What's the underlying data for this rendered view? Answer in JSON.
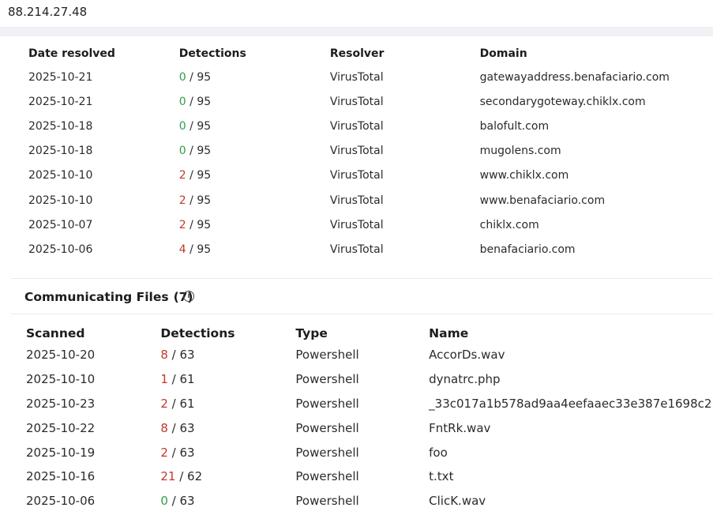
{
  "header": {
    "ip_address": "88.214.27.48"
  },
  "resolutions": {
    "columns": [
      "Date resolved",
      "Detections",
      "Resolver",
      "Domain"
    ],
    "rows": [
      {
        "date": "2025-10-21",
        "det": "0",
        "total": "95",
        "resolver": "VirusTotal",
        "domain": "gatewayaddress.benafaciario.com"
      },
      {
        "date": "2025-10-21",
        "det": "0",
        "total": "95",
        "resolver": "VirusTotal",
        "domain": "secondarygoteway.chiklx.com"
      },
      {
        "date": "2025-10-18",
        "det": "0",
        "total": "95",
        "resolver": "VirusTotal",
        "domain": "balofult.com"
      },
      {
        "date": "2025-10-18",
        "det": "0",
        "total": "95",
        "resolver": "VirusTotal",
        "domain": "mugolens.com"
      },
      {
        "date": "2025-10-10",
        "det": "2",
        "total": "95",
        "resolver": "VirusTotal",
        "domain": "www.chiklx.com"
      },
      {
        "date": "2025-10-10",
        "det": "2",
        "total": "95",
        "resolver": "VirusTotal",
        "domain": "www.benafaciario.com"
      },
      {
        "date": "2025-10-07",
        "det": "2",
        "total": "95",
        "resolver": "VirusTotal",
        "domain": "chiklx.com"
      },
      {
        "date": "2025-10-06",
        "det": "4",
        "total": "95",
        "resolver": "VirusTotal",
        "domain": "benafaciario.com"
      }
    ]
  },
  "communicating_files": {
    "title": "Communicating Files",
    "count": "(7)",
    "info_icon": "info-icon",
    "columns": [
      "Scanned",
      "Detections",
      "Type",
      "Name"
    ],
    "rows": [
      {
        "scanned": "2025-10-20",
        "det": "8",
        "total": "63",
        "type": "Powershell",
        "name": "AccorDs.wav"
      },
      {
        "scanned": "2025-10-10",
        "det": "1",
        "total": "61",
        "type": "Powershell",
        "name": "dynatrc.php"
      },
      {
        "scanned": "2025-10-23",
        "det": "2",
        "total": "61",
        "type": "Powershell",
        "name": "_33c017a1b578ad9aa4eefaaec33e387e1698c2"
      },
      {
        "scanned": "2025-10-22",
        "det": "8",
        "total": "63",
        "type": "Powershell",
        "name": "FntRk.wav"
      },
      {
        "scanned": "2025-10-19",
        "det": "2",
        "total": "63",
        "type": "Powershell",
        "name": "foo"
      },
      {
        "scanned": "2025-10-16",
        "det": "21",
        "total": "62",
        "type": "Powershell",
        "name": "t.txt"
      },
      {
        "scanned": "2025-10-06",
        "det": "0",
        "total": "63",
        "type": "Powershell",
        "name": "ClicK.wav"
      }
    ]
  },
  "colors": {
    "clean": "#2e9e4a",
    "malicious": "#c0392b"
  }
}
